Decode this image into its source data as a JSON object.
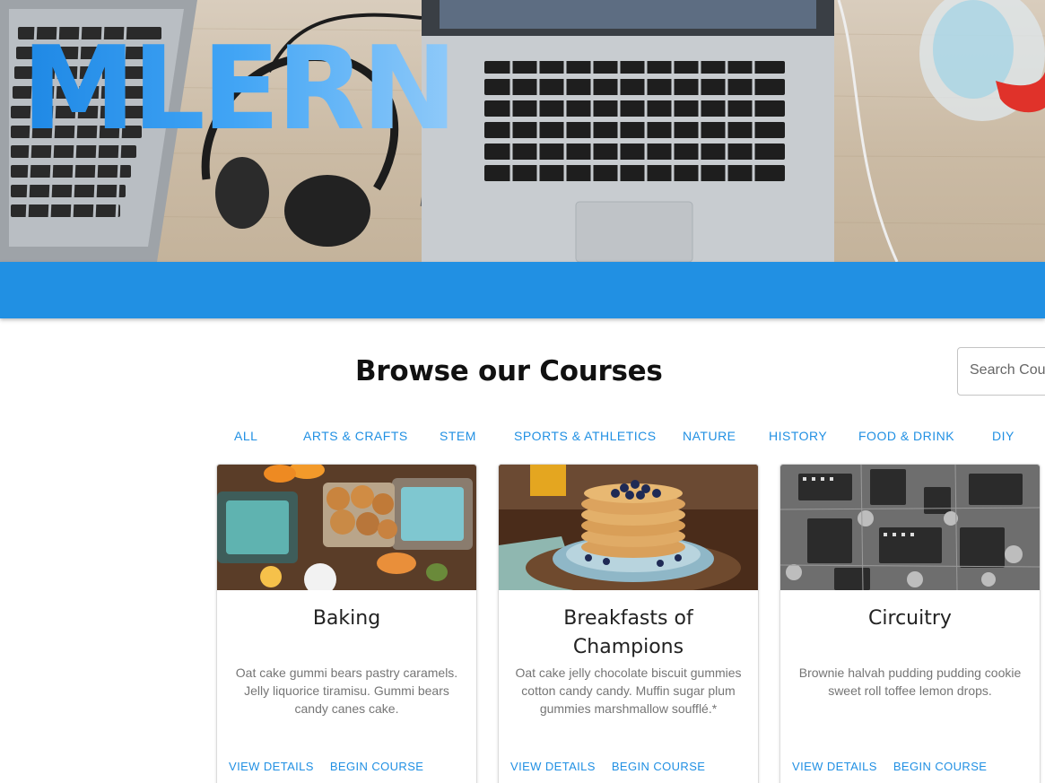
{
  "hero": {
    "logo_text": "MLERN"
  },
  "main": {
    "heading": "Browse our Courses",
    "search": {
      "placeholder": "Search Courses",
      "value": ""
    },
    "tabs": [
      {
        "label": "ALL"
      },
      {
        "label": "ARTS & CRAFTS"
      },
      {
        "label": "STEM"
      },
      {
        "label": "SPORTS & ATHLETICS"
      },
      {
        "label": "NATURE"
      },
      {
        "label": "HISTORY"
      },
      {
        "label": "FOOD & DRINK"
      },
      {
        "label": "DIY"
      }
    ],
    "courses": [
      {
        "title": "Baking",
        "description": "Oat cake gummi bears pastry caramels. Jelly liquorice tiramisu. Gummi bears candy canes cake.",
        "view_label": "VIEW DETAILS",
        "begin_label": "BEGIN COURSE"
      },
      {
        "title": "Breakfasts of Champions",
        "description": "Oat cake jelly chocolate biscuit gummies cotton candy candy. Muffin sugar plum gummies marshmallow soufflé.*",
        "view_label": "VIEW DETAILS",
        "begin_label": "BEGIN COURSE"
      },
      {
        "title": "Circuitry",
        "description": "Brownie halvah pudding pudding cookie sweet roll toffee lemon drops.",
        "view_label": "VIEW DETAILS",
        "begin_label": "BEGIN COURSE"
      }
    ]
  },
  "colors": {
    "accent": "#2190e3",
    "logo_gradient_start": "#1e88e5",
    "logo_gradient_end": "#90caf9",
    "heading": "#111111",
    "card_text": "#757575"
  },
  "icons": [
    "laptop-image",
    "headphones-image",
    "water-bottle-image",
    "baking-photo",
    "pancakes-photo",
    "circuit-board-photo"
  ]
}
